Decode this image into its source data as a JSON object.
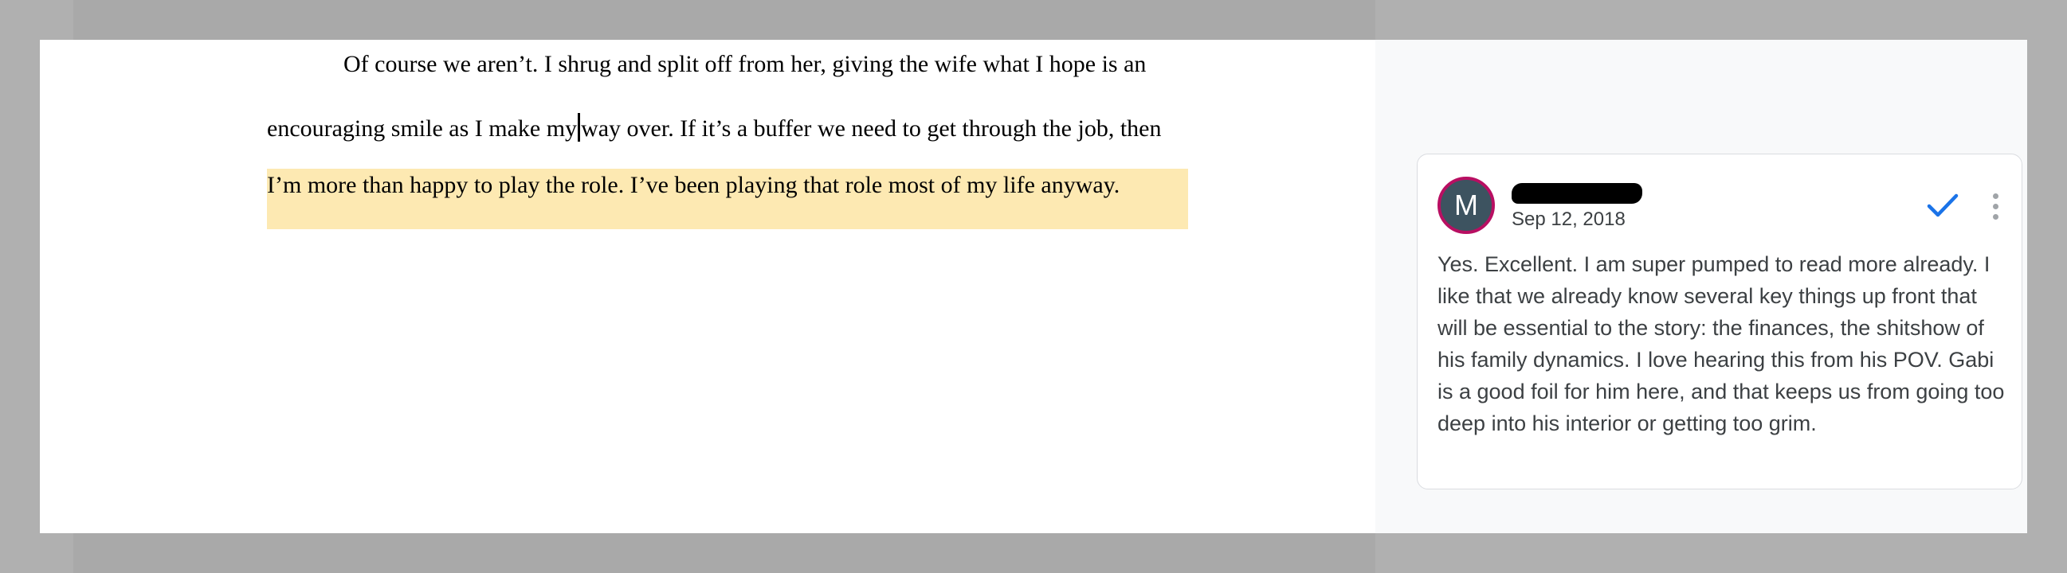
{
  "document": {
    "line_1": "Of course we aren’t. I shrug and split off from her, giving the wife what I hope is an",
    "line_2_before_cursor": "encouraging smile as I make my",
    "line_2_after_cursor": "way over. If it’s a buffer we need to get through the job, then",
    "line_3": "I’m more than happy to play the role. I’ve been playing that role most of my life anyway.",
    "highlight_color": "#fde9b2"
  },
  "comment": {
    "avatar_initial": "M",
    "avatar_color": "#3d5360",
    "avatar_ring_color": "#b80f62",
    "date": "Sep 12, 2018",
    "body": "Yes. Excellent. I am super pumped to read more already. I like that we already know several key things up front that will be essential to the story: the finances, the shitshow of his family dynamics. I love hearing this from his POV. Gabi is a good foil for him here, and that keeps us from going too deep into his interior or getting too grim.",
    "resolve_icon": "checkmark-icon",
    "more_icon": "more-vert-icon",
    "accent_color": "#1a73e8"
  }
}
